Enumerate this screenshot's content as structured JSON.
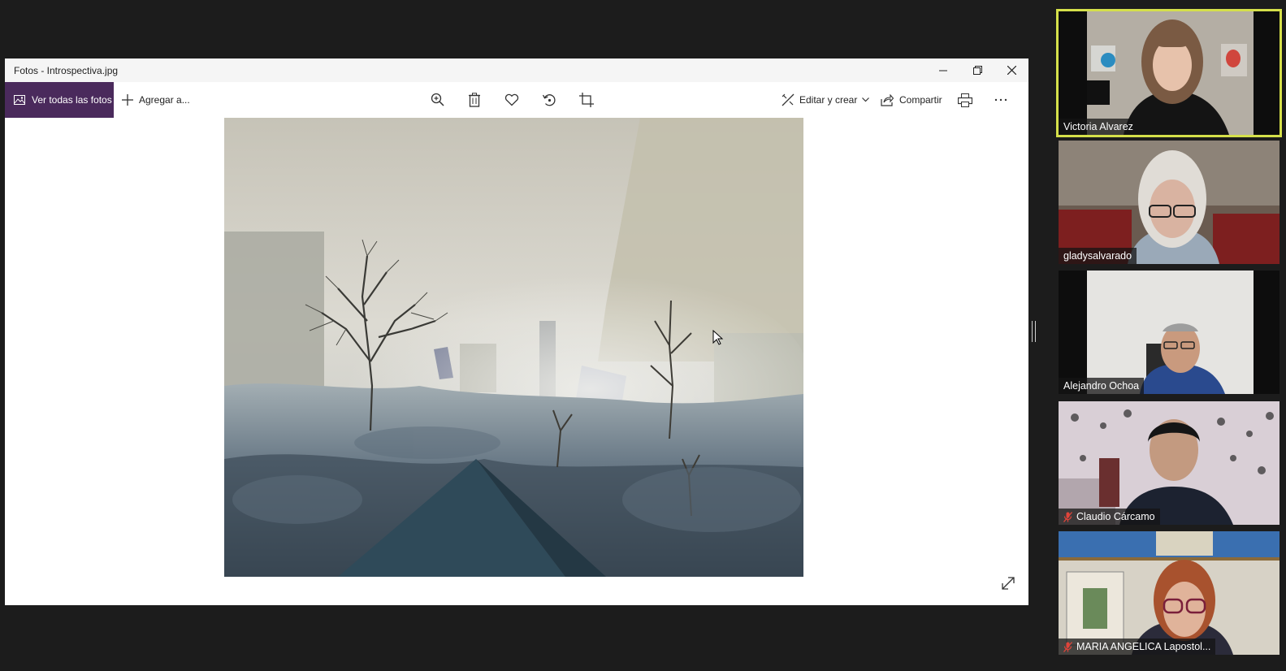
{
  "window": {
    "title": "Fotos - Introspectiva.jpg",
    "minimize": "minimize-icon",
    "maximize": "restore-icon",
    "close": "close-icon"
  },
  "toolbar": {
    "all_photos_label": "Ver todas las fotos",
    "add_label": "Agregar a...",
    "tools": [
      "zoom-in-icon",
      "delete-icon",
      "favorite-icon",
      "rotate-icon",
      "crop-icon"
    ],
    "edit_label": "Editar y crear",
    "share_label": "Compartir",
    "print": "print-icon",
    "more": "more-icon"
  },
  "participants": [
    {
      "name": "Victoria Alvarez",
      "active": true,
      "muted": false
    },
    {
      "name": "gladysalvarado",
      "active": false,
      "muted": false
    },
    {
      "name": "Alejandro Ochoa",
      "active": false,
      "muted": false
    },
    {
      "name": "Claudio Cárcamo",
      "active": false,
      "muted": true
    },
    {
      "name": "MARIA ANGELICA Lapostol...",
      "active": false,
      "muted": true
    }
  ],
  "colors": {
    "accent": "#4a2a5c",
    "active_speaker": "#d5e04a",
    "mute": "#e0443a"
  }
}
